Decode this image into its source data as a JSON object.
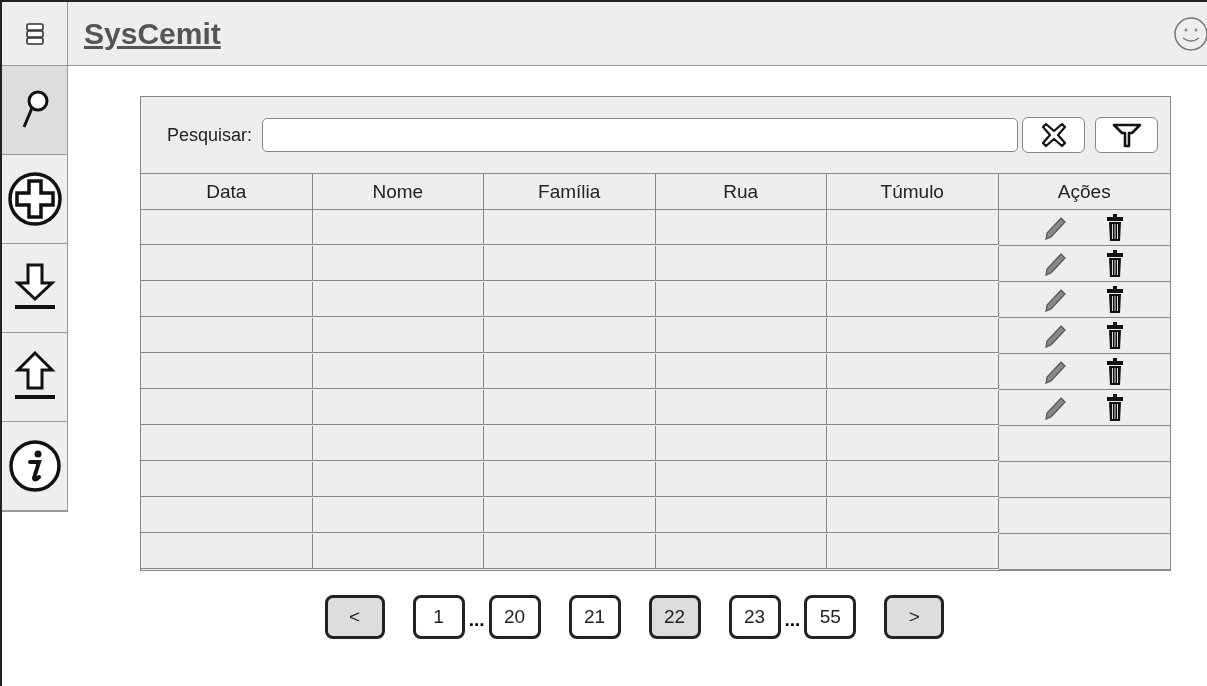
{
  "app": {
    "title": "SysCemit"
  },
  "sidebar": {
    "items": [
      {
        "kind": "search",
        "selected": true
      },
      {
        "kind": "add",
        "selected": false
      },
      {
        "kind": "download",
        "selected": false
      },
      {
        "kind": "upload",
        "selected": false
      },
      {
        "kind": "info",
        "selected": false
      }
    ]
  },
  "search": {
    "label": "Pesquisar:"
  },
  "table": {
    "columns": [
      "Data",
      "Nome",
      "Família",
      "Rua",
      "Túmulo",
      "Ações"
    ],
    "rows": [
      {
        "has_actions": true
      },
      {
        "has_actions": true
      },
      {
        "has_actions": true
      },
      {
        "has_actions": true
      },
      {
        "has_actions": true
      },
      {
        "has_actions": true
      },
      {
        "has_actions": false
      },
      {
        "has_actions": false
      },
      {
        "has_actions": false
      },
      {
        "has_actions": false
      }
    ]
  },
  "pagination": [
    {
      "kind": "prev",
      "label": "<"
    },
    {
      "kind": "page",
      "label": "1",
      "selected": false
    },
    {
      "kind": "ellipsis",
      "label": "..."
    },
    {
      "kind": "page",
      "label": "20",
      "selected": false
    },
    {
      "kind": "page",
      "label": "21",
      "selected": false
    },
    {
      "kind": "page",
      "label": "22",
      "selected": true
    },
    {
      "kind": "page",
      "label": "23",
      "selected": false
    },
    {
      "kind": "ellipsis",
      "label": "..."
    },
    {
      "kind": "page",
      "label": "55",
      "selected": false
    },
    {
      "kind": "next",
      "label": ">"
    }
  ]
}
